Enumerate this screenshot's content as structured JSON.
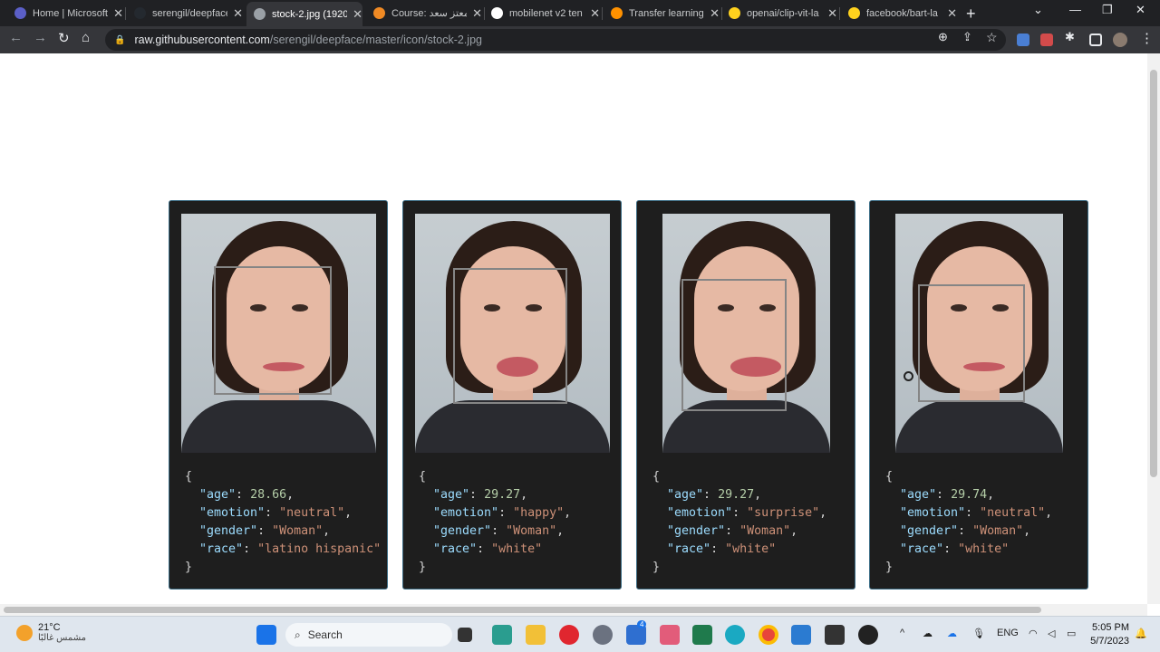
{
  "browser": {
    "tabs": [
      {
        "title": "Home | Microsoft",
        "color": "#5b5fc7",
        "active": false
      },
      {
        "title": "serengil/deepface",
        "color": "#24292f",
        "active": false
      },
      {
        "title": "stock-2.jpg (1920",
        "color": "#9aa0a6",
        "active": true
      },
      {
        "title": "Course: معتز سعد",
        "color": "#f08a24",
        "active": false
      },
      {
        "title": "mobilenet v2 ten",
        "color": "#ffffff",
        "active": false
      },
      {
        "title": "Transfer learning",
        "color": "#ff9100",
        "active": false
      },
      {
        "title": "openai/clip-vit-la",
        "color": "#ffd21e",
        "active": false
      },
      {
        "title": "facebook/bart-la",
        "color": "#ffd21e",
        "active": false
      }
    ],
    "url_host": "raw.githubusercontent.com",
    "url_path": "/serengil/deepface/master/icon/stock-2.jpg"
  },
  "results": [
    {
      "age": "28.66",
      "emotion": "\"neutral\"",
      "gender": "\"Woman\"",
      "race": "\"latino hispanic\""
    },
    {
      "age": "29.27",
      "emotion": "\"happy\"",
      "gender": "\"Woman\"",
      "race": "\"white\""
    },
    {
      "age": "29.27",
      "emotion": "\"surprise\"",
      "gender": "\"Woman\"",
      "race": "\"white\""
    },
    {
      "age": "29.74",
      "emotion": "\"neutral\"",
      "gender": "\"Woman\"",
      "race": "\"white\""
    }
  ],
  "json_keys": {
    "age": "\"age\"",
    "emotion": "\"emotion\"",
    "gender": "\"gender\"",
    "race": "\"race\""
  },
  "taskbar": {
    "temp": "21°C",
    "weather": "مشمس غالبًا",
    "search_label": "Search",
    "lang": "ENG",
    "time": "5:05 PM",
    "date": "5/7/2023",
    "badge": "4"
  }
}
